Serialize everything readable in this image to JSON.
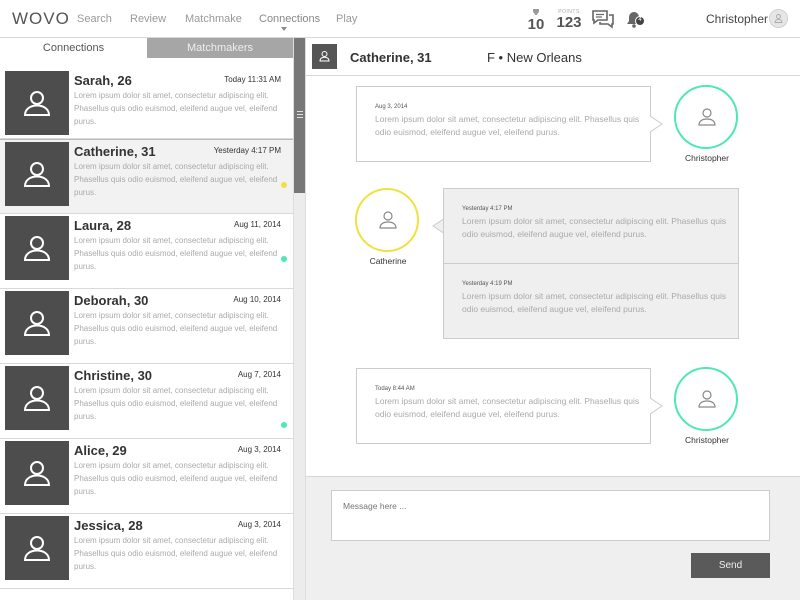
{
  "nav": {
    "logo": "WOVO",
    "items": [
      "Search",
      "Review",
      "Matchmake",
      "Connections",
      "Play"
    ],
    "stat1_small": "",
    "stat1_value": "10",
    "stat2_small": "POINTS",
    "stat2_value": "123",
    "notification_count": "4",
    "user_name": "Christopher"
  },
  "tabs": {
    "connections": "Connections",
    "matchmakers": "Matchmakers"
  },
  "connections": [
    {
      "name": "Sarah, 26",
      "date": "Today 11:31 AM",
      "preview": "Lorem ipsum dolor sit amet, consectetur adipiscing elit. Phasellus quis odio euismod, eleifend augue vel, eleifend purus.",
      "dot": ""
    },
    {
      "name": "Catherine, 31",
      "date": "Yesterday 4:17 PM",
      "preview": "Lorem ipsum dolor sit amet, consectetur adipiscing elit. Phasellus quis odio euismod, eleifend augue vel, eleifend purus.",
      "dot": "#f0e040"
    },
    {
      "name": "Laura, 28",
      "date": "Aug 11, 2014",
      "preview": "Lorem ipsum dolor sit amet, consectetur adipiscing elit. Phasellus quis odio euismod, eleifend augue vel, eleifend purus.",
      "dot": "#4de8b5"
    },
    {
      "name": "Deborah, 30",
      "date": "Aug 10, 2014",
      "preview": "Lorem ipsum dolor sit amet, consectetur adipiscing elit. Phasellus quis odio euismod, eleifend augue vel, eleifend purus.",
      "dot": ""
    },
    {
      "name": "Christine, 30",
      "date": "Aug 7, 2014",
      "preview": "Lorem ipsum dolor sit amet, consectetur adipiscing elit. Phasellus quis odio euismod, eleifend augue vel, eleifend purus.",
      "dot": "#4de8b5"
    },
    {
      "name": "Alice, 29",
      "date": "Aug 3, 2014",
      "preview": "Lorem ipsum dolor sit amet, consectetur adipiscing elit. Phasellus quis odio euismod, eleifend augue vel, eleifend purus.",
      "dot": ""
    },
    {
      "name": "Jessica, 28",
      "date": "Aug 3, 2014",
      "preview": "Lorem ipsum dolor sit amet, consectetur adipiscing elit. Phasellus quis odio euismod, eleifend augue vel, eleifend purus.",
      "dot": ""
    }
  ],
  "chat": {
    "name": "Catherine, 31",
    "info": "F • New Orleans",
    "messages": [
      {
        "sender": "Christopher",
        "date": "Aug 3, 2014",
        "text": "Lorem ipsum dolor sit amet, consectetur adipiscing elit. Phasellus quis odio euismod, eleifend augue vel, eleifend purus."
      },
      {
        "sender": "Catherine",
        "date": "Yesterday 4:17 PM",
        "text": "Lorem ipsum dolor sit amet, consectetur adipiscing elit. Phasellus quis odio euismod, eleifend augue vel, eleifend purus."
      },
      {
        "sender": "Catherine",
        "date": "Yesterday 4:19 PM",
        "text": "Lorem ipsum dolor sit amet, consectetur adipiscing elit. Phasellus quis odio euismod, eleifend augue vel, eleifend purus."
      },
      {
        "sender": "Christopher",
        "date": "Today 8:44 AM",
        "text": "Lorem ipsum dolor sit amet, consectetur adipiscing elit. Phasellus quis odio euismod, eleifend augue vel, eleifend purus."
      }
    ],
    "christopher_color": "#4de8b5",
    "catherine_color": "#f0e040"
  },
  "composer": {
    "placeholder": "Message here ...",
    "send_label": "Send"
  },
  "icons": {
    "avatar": "person-icon",
    "messages": "chat-bubbles-icon",
    "notifications": "bell-icon",
    "stat1": "trophy-icon"
  }
}
